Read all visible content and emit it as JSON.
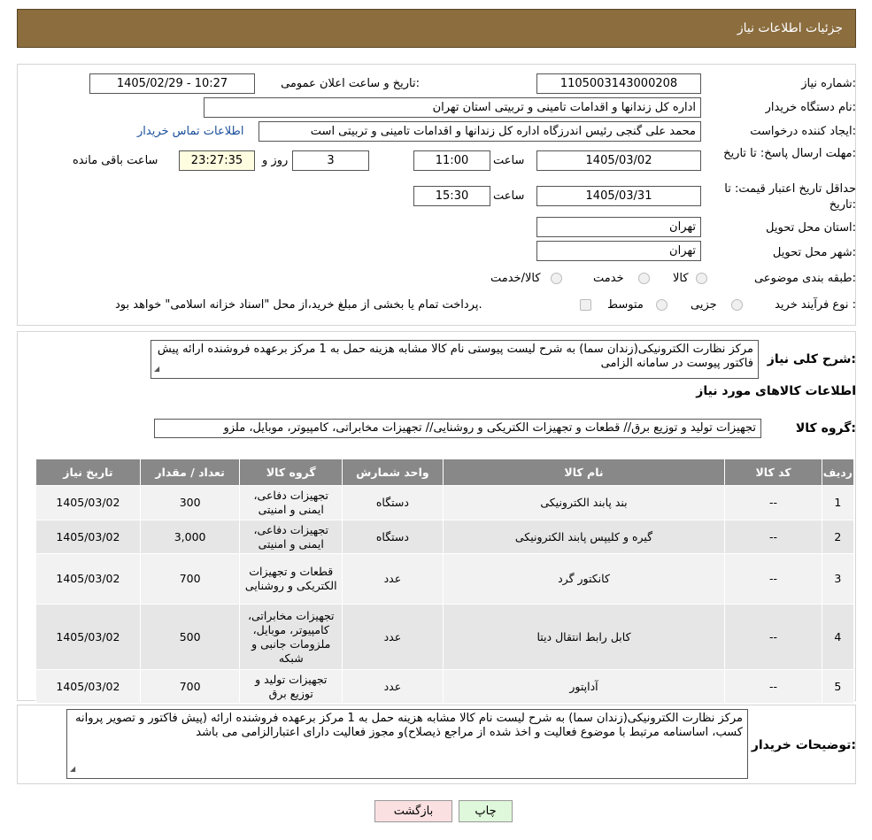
{
  "header": {
    "title": "جزئیات اطلاعات نیاز"
  },
  "need_number": {
    "label": "شماره نیاز:",
    "value": "1105003143000208"
  },
  "announce": {
    "label": "تاریخ و ساعت اعلان عمومی:",
    "value": "1405/02/29 - 10:27"
  },
  "buyer": {
    "label": "نام دستگاه خریدار:",
    "value": "اداره کل زندانها و اقدامات تامینی و تربیتی استان تهران"
  },
  "creator": {
    "label": "ایجاد کننده درخواست:",
    "value": "محمد علی گنجی رئیس اندرزگاه  اداره کل زندانها و اقدامات تامینی و تربیتی است",
    "contact_link": "اطلاعات تماس خریدار"
  },
  "deadline": {
    "label": "مهلت ارسال پاسخ: تا تاریخ:",
    "date": "1405/03/02",
    "time_label": "ساعت",
    "time": "11:00",
    "days": "3",
    "days_label": "روز و",
    "remaining": "23:27:35",
    "remaining_label": "ساعت باقی مانده"
  },
  "validity": {
    "label": "حداقل تاریخ اعتبار قیمت: تا تاریخ:",
    "date": "1405/03/31",
    "time_label": "ساعت",
    "time": "15:30"
  },
  "province": {
    "label": "استان محل تحویل:",
    "value": "تهران"
  },
  "city": {
    "label": "شهر محل تحویل:",
    "value": "تهران"
  },
  "category": {
    "label": "طبقه بندی موضوعی:",
    "options": [
      "کالا",
      "خدمت",
      "کالا/خدمت"
    ]
  },
  "process": {
    "label": "نوع فرآیند خرید :",
    "options": [
      "جزیی",
      "متوسط"
    ],
    "note": "پرداخت تمام یا بخشی از مبلغ خرید،از محل \"اسناد خزانه اسلامی\" خواهد بود."
  },
  "general_desc": {
    "label": "شرح کلی نیاز:",
    "value": "مرکز نظارت الکترونیکی(زندان سما) به شرح لیست پیوستی نام کالا مشابه هزینه حمل به 1 مرکز برعهده فروشنده ارائه پیش فاکتور  پیوست در سامانه الزامی"
  },
  "goods_info_title": "اطلاعات کالاهای مورد نیاز",
  "goods_group": {
    "label": "گروه کالا:",
    "value": "تجهیزات تولید و توزیع برق// قطعات و تجهیزات الکتریکی و روشنایی// تجهیزات مخابراتی، کامپیوتر، موبایل، ملزو"
  },
  "table": {
    "headers": [
      "ردیف",
      "کد کالا",
      "نام کالا",
      "واحد شمارش",
      "گروه کالا",
      "تعداد / مقدار",
      "تاریخ نیاز"
    ],
    "rows": [
      [
        "1",
        "--",
        "بند پابند الکترونیکی",
        "دستگاه",
        "تجهیزات دفاعی، ایمنی و امنیتی",
        "300",
        "1405/03/02"
      ],
      [
        "2",
        "--",
        "گیره و کلیپس پابند الکترونیکی",
        "دستگاه",
        "تجهیزات دفاعی، ایمنی و امنیتی",
        "3,000",
        "1405/03/02"
      ],
      [
        "3",
        "--",
        "کانکتور گرد",
        "عدد",
        "قطعات و تجهیزات الکتریکی و روشنایی",
        "700",
        "1405/03/02"
      ],
      [
        "4",
        "--",
        "کابل رابط انتقال دیتا",
        "عدد",
        "تجهیزات مخابراتی، کامپیوتر، موبایل، ملزومات جانبی و شبکه",
        "500",
        "1405/03/02"
      ],
      [
        "5",
        "--",
        "آداپتور",
        "عدد",
        "تجهیزات تولید و توزیع برق",
        "700",
        "1405/03/02"
      ]
    ]
  },
  "buyer_notes": {
    "label": "توضیحات خریدار:",
    "value": "مرکز نظارت الکترونیکی(زندان سما) به شرح لیست نام کالا مشابه هزینه حمل  به 1 مرکز برعهده فروشنده ارائه (پیش فاکتور و  تصویر پروانه کسب، اساسنامه مرتبط با موضوع فعالیت و اخذ شده از مراجع ذیصلاح)و مجوز فعالیت دارای اعتبارالزامی می باشد"
  },
  "buttons": {
    "print": "چاپ",
    "back": "بازگشت"
  },
  "colors": {
    "header": "#8b6d3e",
    "table_header": "#888888",
    "link": "#1a4f9a",
    "print_btn": "#dff7da",
    "back_btn": "#fbe0e2"
  }
}
